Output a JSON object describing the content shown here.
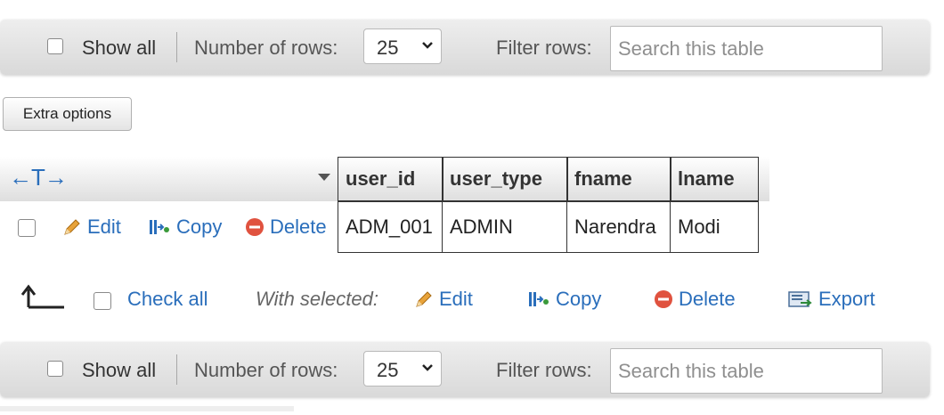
{
  "navbar": {
    "show_all_label": "Show all",
    "rows_label": "Number of rows:",
    "rows_value": "25",
    "filter_label": "Filter rows:",
    "search_placeholder": "Search this table"
  },
  "extra_options_label": "Extra options",
  "table": {
    "sort_arrows": "←T→",
    "columns": [
      "user_id",
      "user_type",
      "fname",
      "lname"
    ],
    "rows": [
      {
        "actions": {
          "edit": "Edit",
          "copy": "Copy",
          "delete": "Delete"
        },
        "cells": [
          "ADM_001",
          "ADMIN",
          "Narendra",
          "Modi"
        ]
      }
    ]
  },
  "bulk": {
    "check_all_label": "Check all",
    "with_selected_label": "With selected:",
    "edit_label": "Edit",
    "copy_label": "Copy",
    "delete_label": "Delete",
    "export_label": "Export"
  },
  "colors": {
    "link": "#2a6ebb",
    "delete_icon": "#e0523f",
    "edit_icon": "#e8a33a"
  },
  "icons": [
    "pencil-icon",
    "copy-icon",
    "delete-icon",
    "export-icon",
    "chevron-down-icon",
    "arrow-up-icon"
  ]
}
